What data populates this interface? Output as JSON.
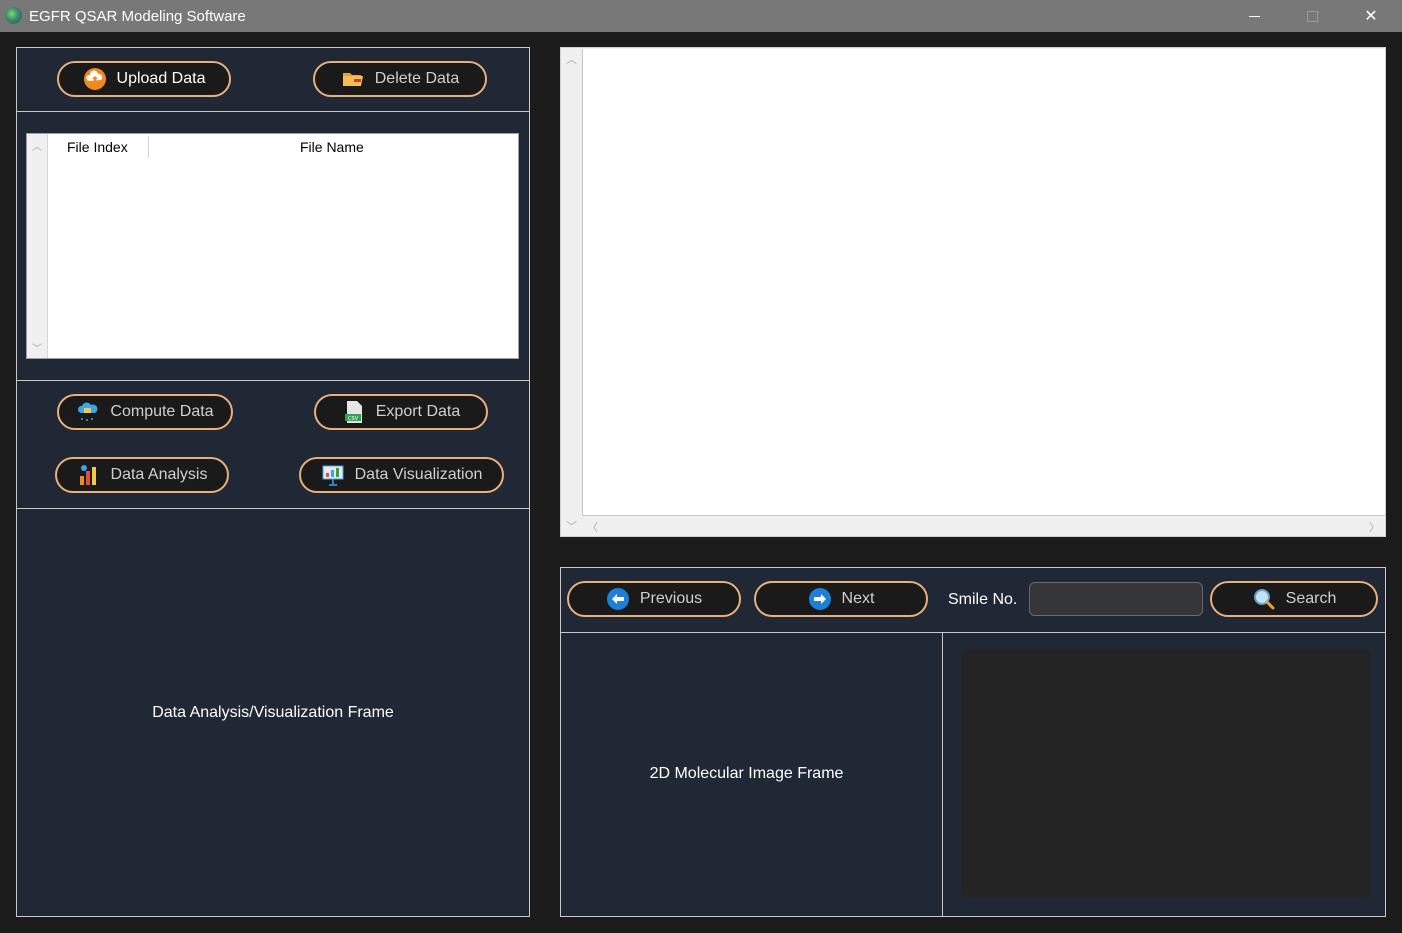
{
  "window": {
    "title": "EGFR QSAR Modeling Software",
    "close_glyph": "✕"
  },
  "data_panel": {
    "upload_label": "Upload Data",
    "delete_label": "Delete Data",
    "table": {
      "columns": [
        "File Index",
        "File Name"
      ],
      "rows": []
    },
    "compute_label": "Compute Data",
    "export_label": "Export Data",
    "analysis_label": "Data Analysis",
    "visualization_label": "Data Visualization",
    "analysis_frame_label": "Data Analysis/Visualization Frame"
  },
  "navigator": {
    "previous_label": "Previous",
    "next_label": "Next",
    "smile_label": "Smile No.",
    "smile_value": "",
    "search_label": "Search",
    "mol_frame_label": "2D Molecular Image Frame"
  },
  "icons": {
    "upload": "upload-cloud-icon",
    "delete": "folder-delete-icon",
    "compute": "cloud-compute-icon",
    "export": "csv-file-icon",
    "analysis": "bar-chart-icon",
    "visualization": "presentation-chart-icon",
    "previous": "arrow-left-circle-icon",
    "next": "arrow-right-circle-icon",
    "search": "magnifier-icon"
  },
  "colors": {
    "button_border": "#e8b07a",
    "panel_bg": "#212835",
    "window_bg": "#1b1b1b",
    "nav_icon_blue": "#1e7fd6"
  }
}
